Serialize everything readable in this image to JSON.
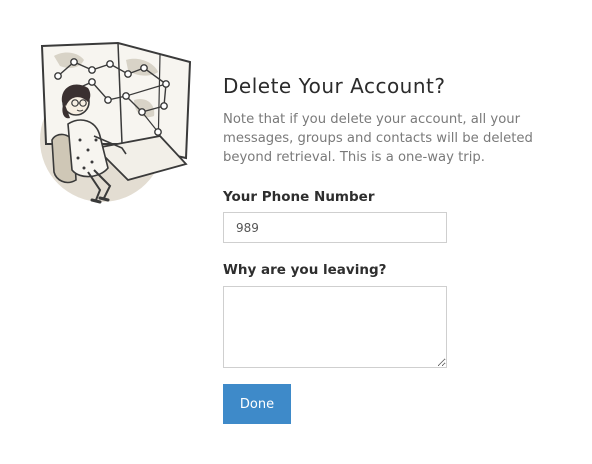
{
  "illustration": {
    "icon": "woman-at-map-desk-illustration"
  },
  "form": {
    "title": "Delete Your Account?",
    "note": "Note that if you delete your account, all your messages, groups and contacts will be deleted beyond retrieval. This is a one-way trip.",
    "phone_label": "Your Phone Number",
    "phone_value": "989",
    "reason_label": "Why are you leaving?",
    "reason_value": "",
    "done_label": "Done"
  },
  "colors": {
    "button_bg": "#3e8ac9",
    "title_text": "#2b2b2b",
    "note_text": "#7a7a7a",
    "input_border": "#cfcfcf",
    "illustration_bg": "#e3ddd2"
  }
}
